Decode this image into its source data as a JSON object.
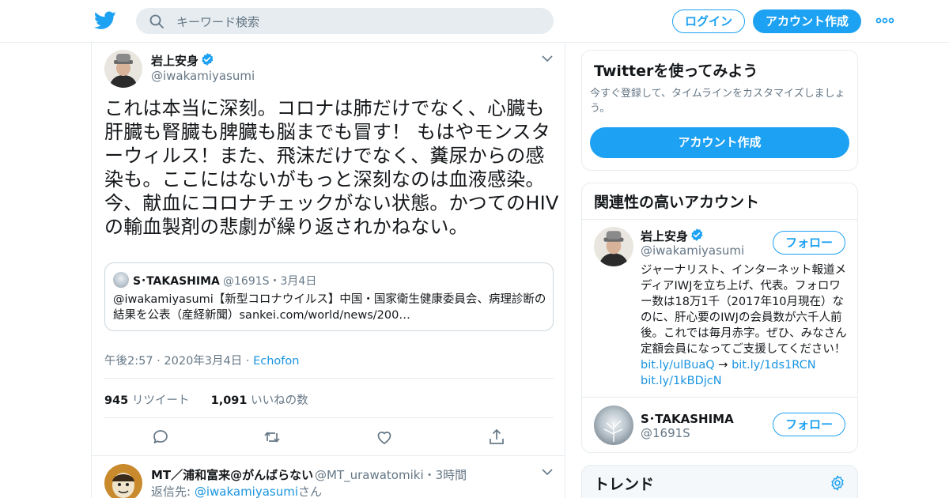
{
  "brand": {
    "accent": "#1da1f2",
    "link": "#1b95e0",
    "icon": "bird-icon"
  },
  "header": {
    "search_placeholder": "キーワード検索",
    "login_label": "ログイン",
    "signup_label": "アカウント作成"
  },
  "tweet": {
    "author_name": "岩上安身",
    "author_handle": "@iwakamiyasumi",
    "text": "これは本当に深刻。コロナは肺だけでなく、心臓も肝臓も腎臓も脾臓も脳までも冒す！ もはやモンスターウィルス！また、飛沫だけでなく、糞尿からの感染も。ここにはないがもっと深刻なのは血液感染。今、献血にコロナチェックがない状態。かつてのHIVの輸血製剤の悲劇が繰り返されかねない。",
    "quote": {
      "name": "S･TAKASHIMA",
      "handle_date": "@1691S・3月4日",
      "text": "@iwakamiyasumi【新型コロナウイルス】中国・国家衛生健康委員会、病理診断の結果を公表（産経新聞）sankei.com/world/news/200…"
    },
    "timestamp": "午後2:57 · 2020年3月4日 · ",
    "client": "Echofon",
    "retweet_count": "945",
    "retweet_label": " リツイート",
    "like_count": "1,091",
    "like_label": " いいねの数"
  },
  "reply": {
    "name": "MT／浦和富来@がんばらない",
    "handle_time": "@MT_urawatomiki・3時間",
    "replying_prefix": "返信先: ",
    "replying_handle": "@iwakamiyasumi",
    "replying_suffix": "さん"
  },
  "sidebar": {
    "signup_card": {
      "title": "Twitterを使ってみよう",
      "subtitle": "今すぐ登録して、タイムラインをカスタマイズしましょう。",
      "button": "アカウント作成"
    },
    "related": {
      "title": "関連性の高いアカウント",
      "accounts": [
        {
          "name": "岩上安身",
          "handle": "@iwakamiyasumi",
          "follow": "フォロー",
          "bio": "ジャーナリスト、インターネット報道メディアIWJを立ち上げ、代表。フォロワー数は18万1千（2017年10月現在）なのに、肝心要のIWJの会員数が六千人前後。これでは毎月赤字。ぜひ、みなさん定額会員になってご支援してください！ ",
          "bio_link1": "bit.ly/ulBuaQ",
          "bio_arrow": " → ",
          "bio_link2": "bit.ly/1ds1RCN",
          "bio_link3": "bit.ly/1kBDjcN"
        },
        {
          "name": "S･TAKASHIMA",
          "handle": "@1691S",
          "follow": "フォロー"
        }
      ]
    },
    "trends": {
      "title": "トレンド"
    }
  }
}
